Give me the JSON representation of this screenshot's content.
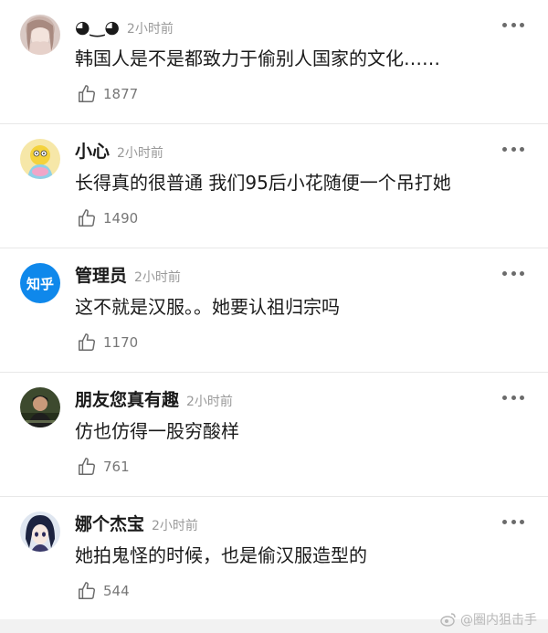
{
  "comments": [
    {
      "username": "◕‿◕",
      "time": "2小时前",
      "text": "韩国人是不是都致力于偷别人国家的文化……",
      "likes": "1877",
      "avatar": "girl-portrait"
    },
    {
      "username": "小心",
      "time": "2小时前",
      "text": "长得真的很普通 我们95后小花随便一个吊打她",
      "likes": "1490",
      "avatar": "cartoon-character"
    },
    {
      "username": "管理员",
      "time": "2小时前",
      "text": "这不就是汉服。。她要认祖归宗吗",
      "likes": "1170",
      "avatar_text": "知乎",
      "avatar": "zhihu-logo"
    },
    {
      "username": "朋友您真有趣",
      "time": "2小时前",
      "text": "仿也仿得一股穷酸样",
      "likes": "761",
      "avatar": "person-photo"
    },
    {
      "username": "娜个杰宝",
      "time": "2小时前",
      "text": "她拍鬼怪的时候，也是偷汉服造型的",
      "likes": "544",
      "avatar": "anime-character"
    }
  ],
  "watermark": "@圈内狙击手",
  "colors": {
    "text": "#1a1a1a",
    "meta": "#999999",
    "zhihu_blue": "#0f88eb",
    "divider": "#e8e8e8"
  }
}
